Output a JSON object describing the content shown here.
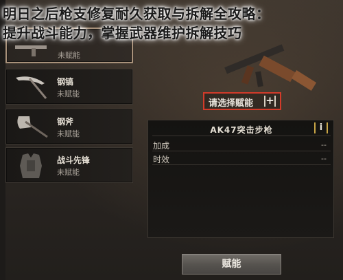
{
  "overlay": {
    "title_line1": "明日之后枪支修复耐久获取与拆解全攻略：",
    "title_line2": "提升战斗能力，掌握武器维护拆解技巧"
  },
  "items": [
    {
      "name": "",
      "status": "未赋能",
      "icon": "selected-item-icon"
    },
    {
      "name": "钢镐",
      "status": "未赋能",
      "icon": "pickaxe-icon"
    },
    {
      "name": "钢斧",
      "status": "未赋能",
      "icon": "axe-icon"
    },
    {
      "name": "战斗先锋",
      "status": "未赋能",
      "icon": "armor-vest-icon"
    }
  ],
  "weapon_display": {
    "icon": "ak47-rifle-icon",
    "select_label": "请选择赋能",
    "plus_icon": "+"
  },
  "info_panel": {
    "title": "AK47突击步枪",
    "info_icon": "i",
    "rows": [
      {
        "label": "加成",
        "value": "--"
      },
      {
        "label": "时效",
        "value": "--"
      }
    ]
  },
  "bottom_button": {
    "label": "赋能"
  },
  "colors": {
    "highlight": "#d23b2a",
    "info_bracket": "#c9a646",
    "panel_bg": "#141311"
  }
}
